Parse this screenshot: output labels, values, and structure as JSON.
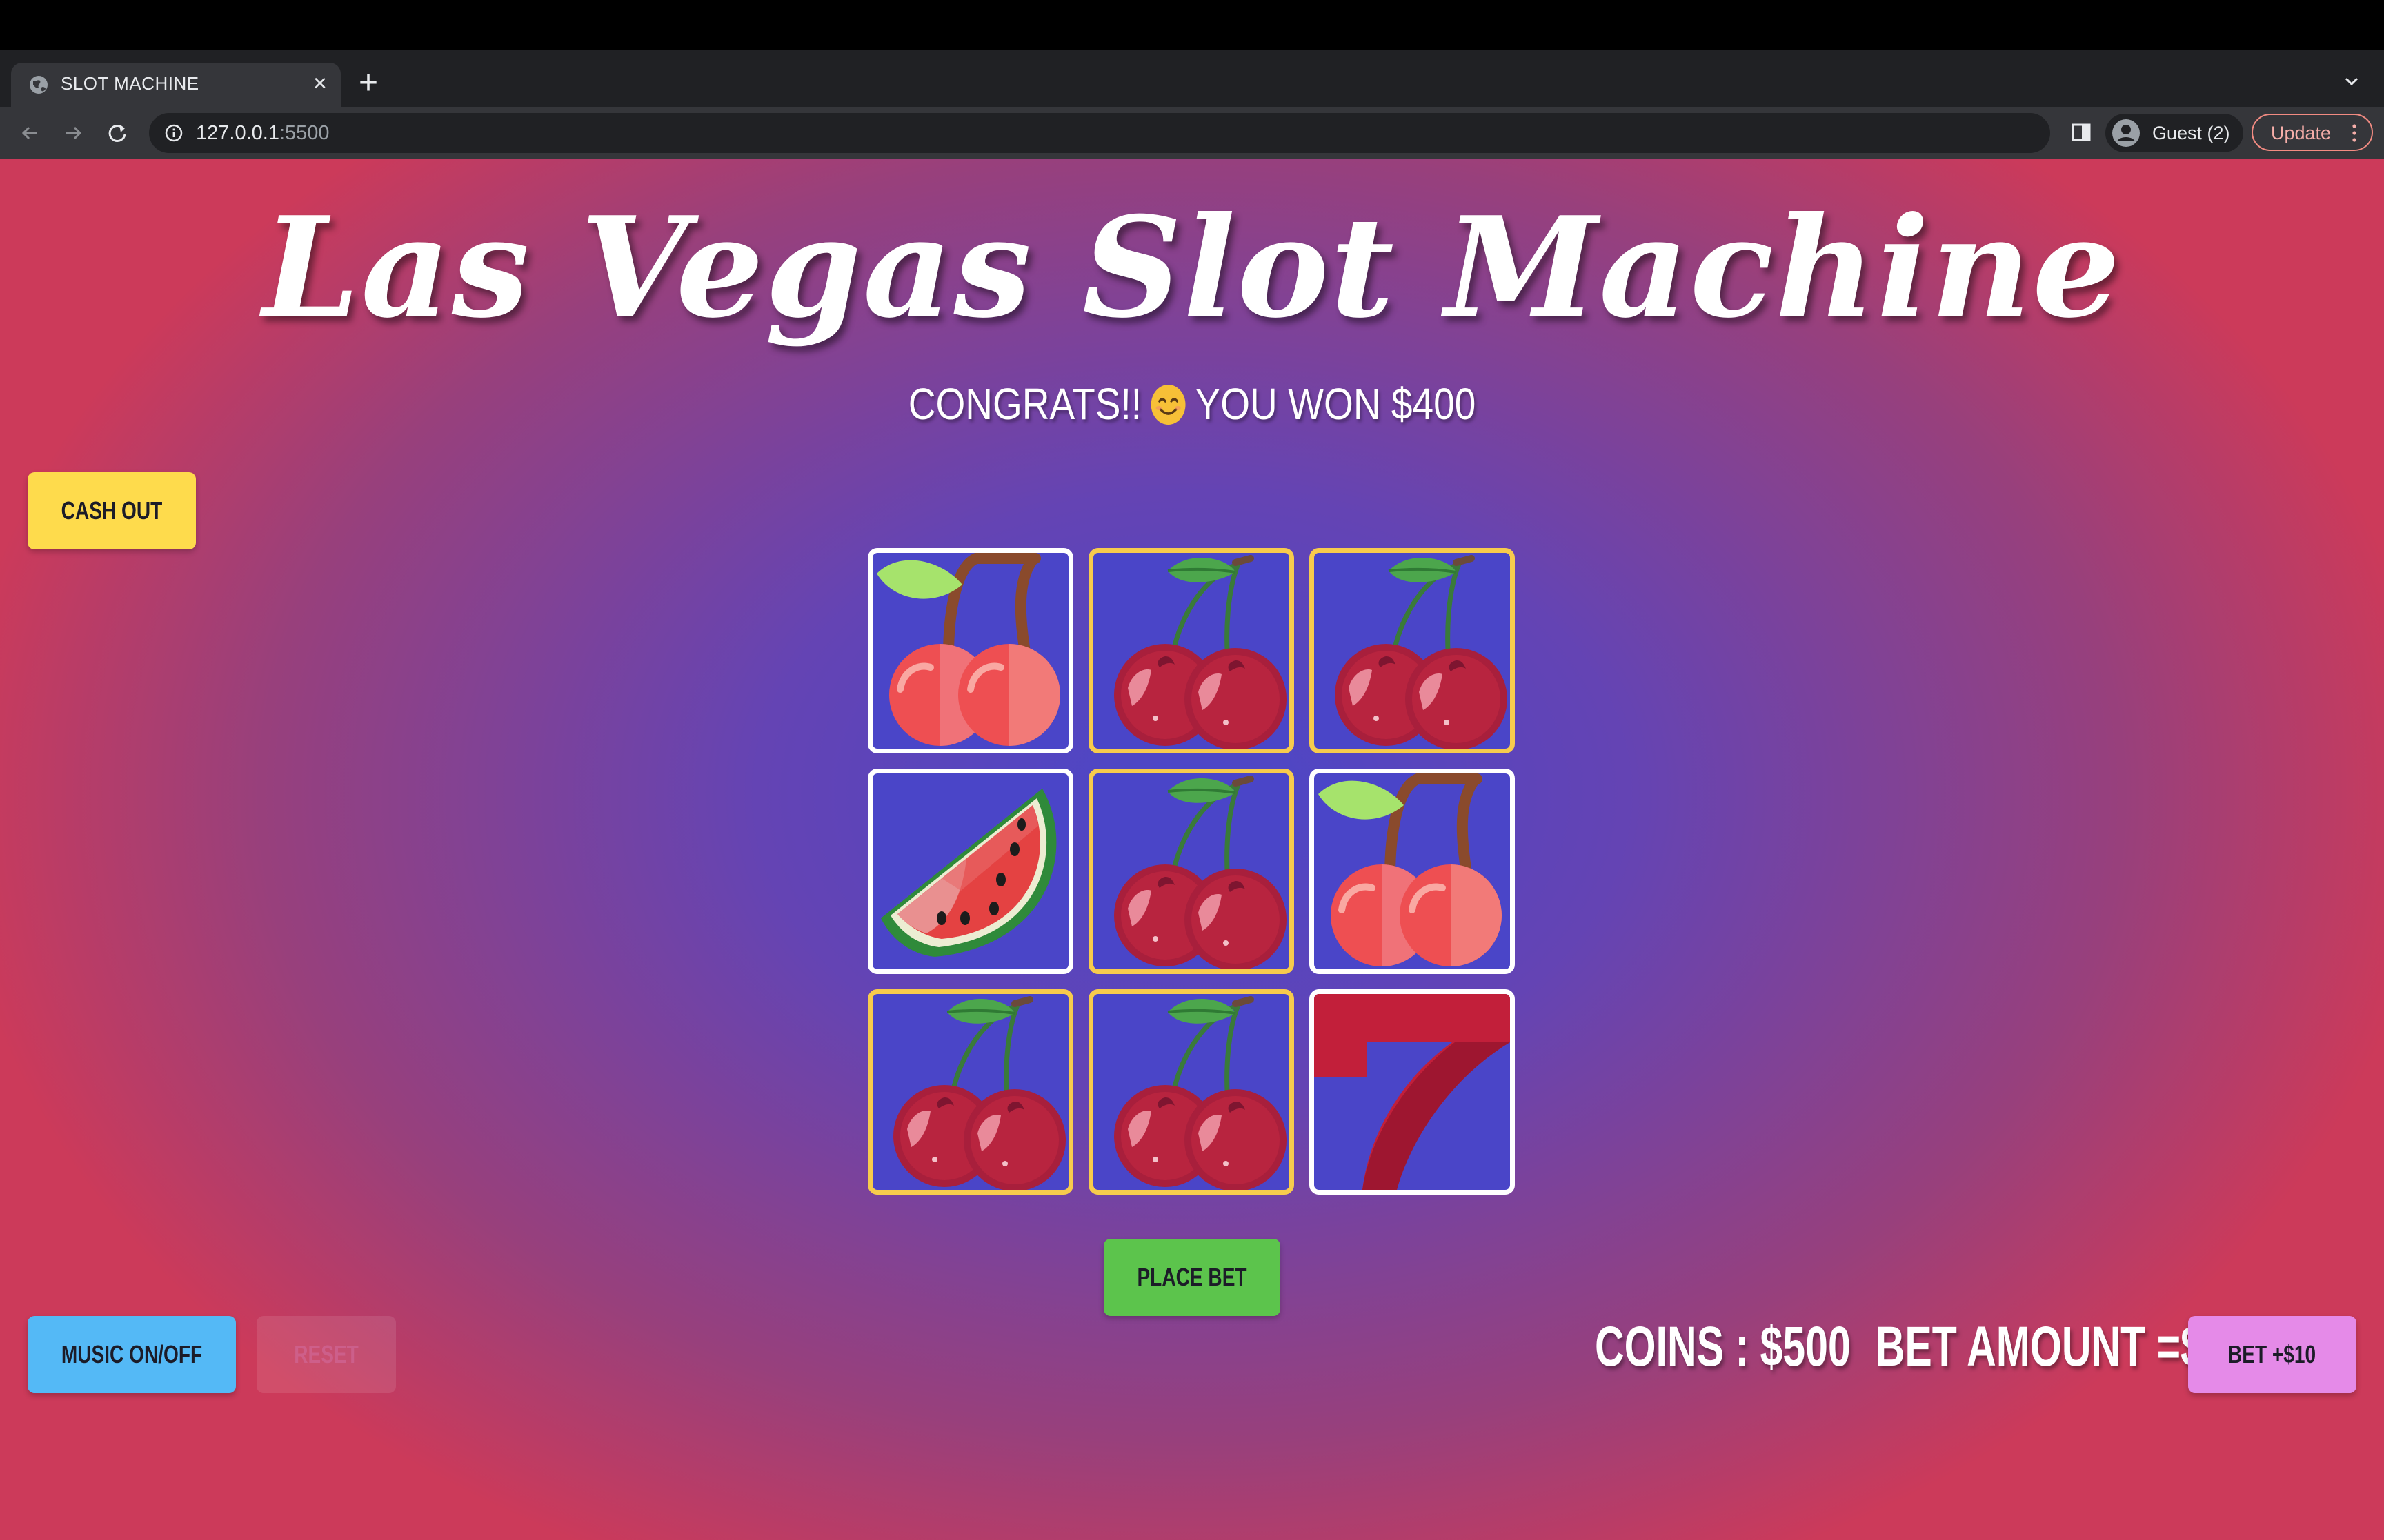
{
  "browser": {
    "tab_title": "SLOT MACHINE",
    "url_host": "127.0.0.1",
    "url_port": ":5500",
    "profile_name": "Guest (2)",
    "update_label": "Update"
  },
  "game": {
    "title": "Las Vegas Slot Machine",
    "message_prefix": "CONGRATS!!",
    "message_suffix": "YOU WON $400",
    "coins_text": "COINS : $500",
    "bet_amount_text": "BET AMOUNT =$10",
    "reels": [
      {
        "symbol": "light-cherry",
        "winning": false
      },
      {
        "symbol": "dark-cherry",
        "winning": true
      },
      {
        "symbol": "dark-cherry",
        "winning": true
      },
      {
        "symbol": "watermelon",
        "winning": false
      },
      {
        "symbol": "dark-cherry",
        "winning": true
      },
      {
        "symbol": "light-cherry",
        "winning": false
      },
      {
        "symbol": "dark-cherry",
        "winning": true
      },
      {
        "symbol": "dark-cherry",
        "winning": true
      },
      {
        "symbol": "seven",
        "winning": false
      }
    ]
  },
  "buttons": {
    "cash_out": "CASH OUT",
    "place_bet": "PLACE BET",
    "music": "MUSIC ON/OFF",
    "reset": "RESET",
    "bet_up": "BET +$10"
  },
  "colors": {
    "cash_out": "#fedb4c",
    "place_bet": "#5cc44c",
    "music": "#54b9f6",
    "bet_up": "#e58ae8",
    "winning_border": "#f7cb4d"
  }
}
